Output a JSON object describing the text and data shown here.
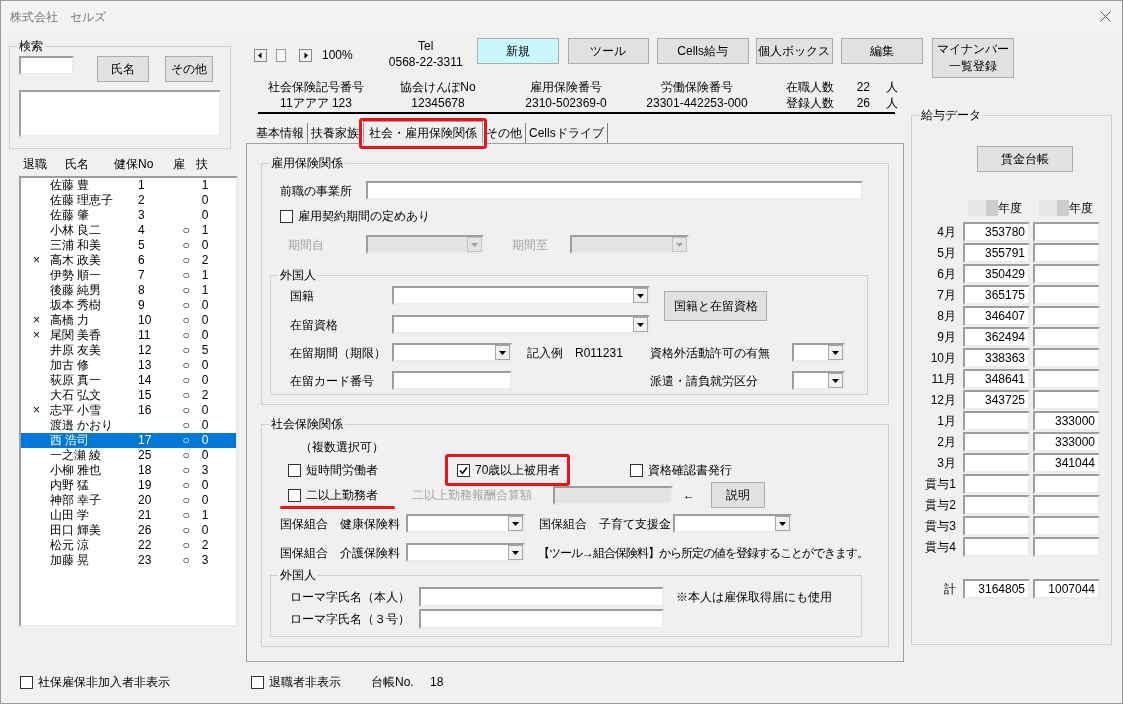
{
  "window": {
    "title": "株式会社　セルズ"
  },
  "search": {
    "title": "検索",
    "buttons": [
      "氏名",
      "その他"
    ]
  },
  "employee_list": {
    "columns": [
      "退職",
      "氏名",
      "健保No",
      "雇",
      "扶"
    ],
    "rows": [
      {
        "name": "佐藤 豊",
        "health_insurance_no": "1",
        "dependents": "1",
        "selected": false
      },
      {
        "name": "佐藤 理恵子",
        "health_insurance_no": "2",
        "dependents": "0",
        "selected": false
      },
      {
        "name": "佐藤 肇",
        "health_insurance_no": "3",
        "dependents": "0",
        "selected": false
      },
      {
        "name": "小林 良二",
        "health_insurance_no": "4",
        "employment_insurance": "○",
        "dependents": "1",
        "selected": false
      },
      {
        "name": "三浦 和美",
        "health_insurance_no": "5",
        "employment_insurance": "○",
        "dependents": "0",
        "selected": false
      },
      {
        "retired": "×",
        "name": "高木 政美",
        "health_insurance_no": "6",
        "employment_insurance": "○",
        "dependents": "2",
        "selected": false
      },
      {
        "name": "伊勢 順一",
        "health_insurance_no": "7",
        "employment_insurance": "○",
        "dependents": "1",
        "selected": false
      },
      {
        "name": "後藤 純男",
        "health_insurance_no": "8",
        "employment_insurance": "○",
        "dependents": "1",
        "selected": false
      },
      {
        "name": "坂本 秀樹",
        "health_insurance_no": "9",
        "employment_insurance": "○",
        "dependents": "0",
        "selected": false
      },
      {
        "retired": "×",
        "name": "高橋 力",
        "health_insurance_no": "10",
        "employment_insurance": "○",
        "dependents": "0",
        "selected": false
      },
      {
        "retired": "×",
        "name": "尾関 美香",
        "health_insurance_no": "11",
        "employment_insurance": "○",
        "dependents": "0",
        "selected": false
      },
      {
        "name": "井原 友美",
        "health_insurance_no": "12",
        "employment_insurance": "○",
        "dependents": "5",
        "selected": false
      },
      {
        "name": "加古 修",
        "health_insurance_no": "13",
        "employment_insurance": "○",
        "dependents": "0",
        "selected": false
      },
      {
        "name": "荻原 真一",
        "health_insurance_no": "14",
        "employment_insurance": "○",
        "dependents": "0",
        "selected": false
      },
      {
        "name": "大石 弘文",
        "health_insurance_no": "15",
        "employment_insurance": "○",
        "dependents": "2",
        "selected": false
      },
      {
        "retired": "×",
        "name": "志平 小雪",
        "health_insurance_no": "16",
        "employment_insurance": "○",
        "dependents": "0",
        "selected": false
      },
      {
        "name": "渡邉 かおり",
        "employment_insurance": "○",
        "dependents": "0",
        "selected": false
      },
      {
        "name": "西 浩司",
        "health_insurance_no": "17",
        "employment_insurance": "○",
        "dependents": "0",
        "selected": true
      },
      {
        "name": "一之瀬 綾",
        "health_insurance_no": "25",
        "employment_insurance": "○",
        "dependents": "0",
        "selected": false
      },
      {
        "name": "小柳 雅也",
        "health_insurance_no": "18",
        "employment_insurance": "○",
        "dependents": "3",
        "selected": false
      },
      {
        "name": "内野 猛",
        "health_insurance_no": "19",
        "employment_insurance": "○",
        "dependents": "0",
        "selected": false
      },
      {
        "name": "神部 幸子",
        "health_insurance_no": "20",
        "employment_insurance": "○",
        "dependents": "0",
        "selected": false
      },
      {
        "name": "山田 学",
        "health_insurance_no": "21",
        "employment_insurance": "○",
        "dependents": "1",
        "selected": false
      },
      {
        "name": "田口 輝美",
        "health_insurance_no": "26",
        "employment_insurance": "○",
        "dependents": "0",
        "selected": false
      },
      {
        "name": "松元 涼",
        "health_insurance_no": "22",
        "employment_insurance": "○",
        "dependents": "2",
        "selected": false
      },
      {
        "name": "加藤 晃",
        "health_insurance_no": "23",
        "employment_insurance": "○",
        "dependents": "3",
        "selected": false
      }
    ]
  },
  "hide_non_enrolled": {
    "label": "社保雇保非加入者非表示",
    "checked": false
  },
  "toolbar": {
    "zoom": "100%",
    "tel_label": "Tel",
    "tel": "0568-22-3311",
    "buttons": [
      {
        "label": "新規",
        "active": true
      },
      {
        "label": "ツール",
        "active": false
      },
      {
        "label": "Cells給与",
        "active": false
      },
      {
        "label": "個人ボックス",
        "active": false
      },
      {
        "label": "編集",
        "active": false
      },
      {
        "label": "マイナンバー一覧登録",
        "active": false
      }
    ]
  },
  "insurance_numbers": [
    {
      "label": "社会保険記号番号",
      "value": "11アアア 123"
    },
    {
      "label": "協会けんぽNo",
      "value": "12345678"
    },
    {
      "label": "雇用保険番号",
      "value": "2310-502369-0"
    },
    {
      "label": "労働保険番号",
      "value": "23301-442253-000"
    }
  ],
  "headcounts": [
    {
      "label": "在職人数",
      "value": "22",
      "unit": "人"
    },
    {
      "label": "登録人数",
      "value": "26",
      "unit": "人"
    }
  ],
  "tabs": [
    {
      "label": "基本情報",
      "selected": false,
      "highlighted": false
    },
    {
      "label": "扶養家族",
      "selected": false,
      "highlighted": false
    },
    {
      "label": "社会・雇用保険関係",
      "selected": true,
      "highlighted": true
    },
    {
      "label": "その他",
      "selected": false,
      "highlighted": false
    },
    {
      "label": "Cellsドライブ",
      "selected": false,
      "highlighted": false
    }
  ],
  "employment_insurance": {
    "title": "雇用保険関係",
    "previous_employer": {
      "label": "前職の事業所"
    },
    "fixed_term": {
      "label": "雇用契約期間の定めあり",
      "checked": false
    },
    "period_from": {
      "label": "期間自",
      "disabled": true
    },
    "period_to": {
      "label": "期間至",
      "disabled": true
    },
    "foreigner": {
      "title": "外国人",
      "nationality": {
        "label": "国籍"
      },
      "status_button": "国籍と在留資格",
      "residence_status": {
        "label": "在留資格"
      },
      "residence_period": {
        "label": "在留期間（期限）",
        "example": "記入例　R011231"
      },
      "work_permit": {
        "label": "資格外活動許可の有無"
      },
      "card_number": {
        "label": "在留カード番号"
      },
      "dispatch": {
        "label": "派遣・請負就労区分"
      }
    }
  },
  "social_insurance": {
    "title": "社会保険関係",
    "note": "（複数選択可）",
    "checkboxes": [
      {
        "label": "短時間労働者",
        "checked": false,
        "highlighted": false,
        "underlined": false
      },
      {
        "label": "70歳以上被用者",
        "checked": true,
        "highlighted": true,
        "underlined": false
      },
      {
        "label": "資格確認書発行",
        "checked": false,
        "highlighted": false,
        "underlined": false
      },
      {
        "label": "二以上勤務者",
        "checked": false,
        "highlighted": false,
        "underlined": true
      }
    ],
    "combined_pay": {
      "label": "二以上勤務報酬合算額",
      "disabled": true,
      "arrow": "←",
      "button": "説明"
    },
    "union_fields": [
      {
        "label": "国保組合　健康保険料"
      },
      {
        "label": "国保組合　子育て支援金"
      },
      {
        "label": "国保組合　介護保険料"
      }
    ],
    "union_note": "【ツール→組合保険料】から所定の値を登録することができます。",
    "foreigner": {
      "title": "外国人",
      "fields": [
        {
          "label": "ローマ字氏名（本人）"
        },
        {
          "label": "ローマ字氏名（３号）"
        }
      ],
      "note": "※本人は雇保取得届にも使用"
    }
  },
  "hide_retired": {
    "label": "退職者非表示",
    "checked": false
  },
  "ledger_no": {
    "label": "台帳No.",
    "value": "18"
  },
  "salary_data": {
    "title": "給与データ",
    "button": "賃金台帳",
    "year_columns": [
      {
        "label": "年度",
        "redacted": true
      },
      {
        "label": "年度",
        "redacted": true
      }
    ],
    "rows": [
      {
        "label": "4月",
        "first_year": "353780"
      },
      {
        "label": "5月",
        "first_year": "355791"
      },
      {
        "label": "6月",
        "first_year": "350429"
      },
      {
        "label": "7月",
        "first_year": "365175"
      },
      {
        "label": "8月",
        "first_year": "346407"
      },
      {
        "label": "9月",
        "first_year": "362494"
      },
      {
        "label": "10月",
        "first_year": "338363"
      },
      {
        "label": "11月",
        "first_year": "348641"
      },
      {
        "label": "12月",
        "first_year": "343725"
      },
      {
        "label": "1月",
        "second_year": "333000"
      },
      {
        "label": "2月",
        "second_year": "333000"
      },
      {
        "label": "3月",
        "second_year": "341044"
      },
      {
        "label": "貫与1"
      },
      {
        "label": "貫与2"
      },
      {
        "label": "貫与3"
      },
      {
        "label": "貫与4"
      }
    ],
    "total": {
      "label": "計",
      "first_year": "3164805",
      "second_year": "1007044"
    }
  }
}
